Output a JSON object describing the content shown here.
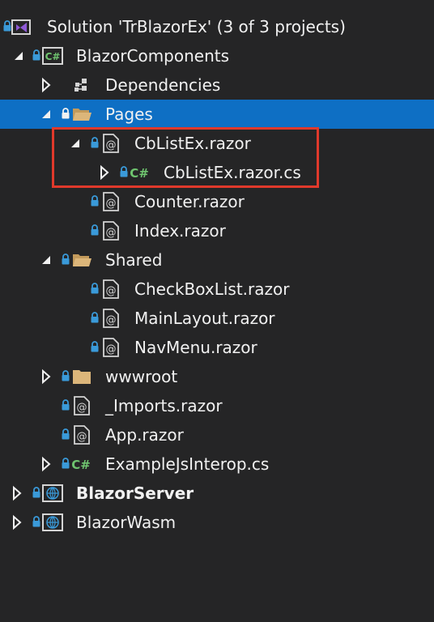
{
  "solution_explorer": {
    "solution": {
      "label": "Solution 'TrBlazorEx' (3 of 3 projects)"
    },
    "items": [
      {
        "label": "BlazorComponents",
        "icon": "csharp-project-icon",
        "expand": "expanded"
      },
      {
        "label": "Dependencies",
        "icon": "dependencies-icon",
        "expand": "collapsed"
      },
      {
        "label": "Pages",
        "icon": "folder-icon",
        "expand": "expanded",
        "selected": true
      },
      {
        "label": "CbListEx.razor",
        "icon": "razor-file-icon",
        "expand": "expanded"
      },
      {
        "label": "CbListEx.razor.cs",
        "icon": "csharp-file-icon",
        "expand": "collapsed"
      },
      {
        "label": "Counter.razor",
        "icon": "razor-file-icon",
        "expand": "none"
      },
      {
        "label": "Index.razor",
        "icon": "razor-file-icon",
        "expand": "none"
      },
      {
        "label": "Shared",
        "icon": "folder-icon",
        "expand": "expanded"
      },
      {
        "label": "CheckBoxList.razor",
        "icon": "razor-file-icon",
        "expand": "none"
      },
      {
        "label": "MainLayout.razor",
        "icon": "razor-file-icon",
        "expand": "none"
      },
      {
        "label": "NavMenu.razor",
        "icon": "razor-file-icon",
        "expand": "none"
      },
      {
        "label": "wwwroot",
        "icon": "folder-icon",
        "expand": "collapsed"
      },
      {
        "label": "_Imports.razor",
        "icon": "razor-file-icon",
        "expand": "none"
      },
      {
        "label": "App.razor",
        "icon": "razor-file-icon",
        "expand": "none"
      },
      {
        "label": "ExampleJsInterop.cs",
        "icon": "csharp-file-icon",
        "expand": "collapsed"
      },
      {
        "label": "BlazorServer",
        "icon": "web-project-icon",
        "expand": "collapsed",
        "bold": true
      },
      {
        "label": "BlazorWasm",
        "icon": "web-project-icon",
        "expand": "collapsed"
      }
    ]
  },
  "colors": {
    "background": "#252526",
    "selection": "#0e6fc4",
    "text": "#f1f1f1",
    "lock": "#3a9ad9",
    "highlight_border": "#e0392b",
    "csharp": "#6fc46f",
    "folder": "#dcb67a",
    "vs_purple": "#8f5ad6"
  }
}
